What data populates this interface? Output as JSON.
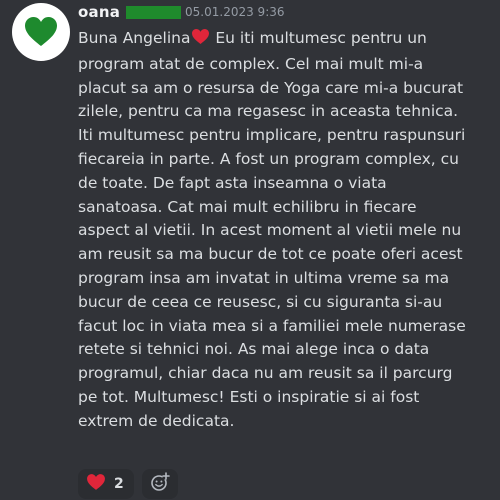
{
  "message": {
    "author": "oana",
    "timestamp": "05.01.2023 9:36",
    "role_color": "#1f8b2c",
    "avatar_icon": "green-heart-icon",
    "lines": [
      "Buna Angelina",
      "program atat de complex. Cel mai mult mi-a",
      "placut sa am o resursa de Yoga care mi-a bucurat",
      "zilele, pentru ca ma regasesc in aceasta tehnica.",
      "Iti multumesc pentru implicare, pentru raspunsuri",
      "fiecareia in parte. A fost un program complex, cu",
      "de toate. De fapt asta inseamna o viata",
      "sanatoasa. Cat mai mult echilibru in fiecare",
      "aspect al vietii. In acest moment al vietii mele nu",
      "am reusit sa ma bucur de tot ce poate oferi acest",
      "program insa am invatat in ultima vreme sa ma",
      "bucur de ceea ce reusesc, si cu siguranta si-au",
      "facut loc in viata mea si a familiei mele numerase",
      "retete si tehnici noi. As mai alege inca o data",
      "programul, chiar daca nu am reusit sa il parcurg",
      "pe tot. Multumesc! Esti o inspiratie si ai fost",
      "extrem de dedicata."
    ],
    "first_line_after_emoji": " Eu iti multumesc pentru un",
    "inline_emoji": "red-heart-icon"
  },
  "reactions": [
    {
      "emoji": "red-heart-icon",
      "count": "2"
    }
  ],
  "add_reaction_icon": "add-reaction-icon"
}
